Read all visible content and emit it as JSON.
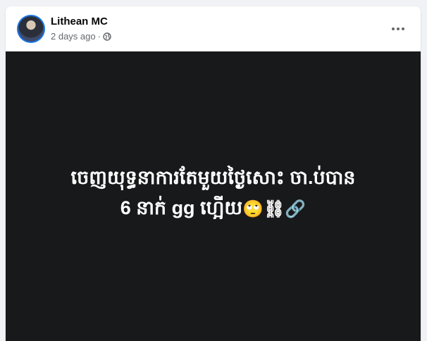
{
  "post": {
    "author": "Lithean MC",
    "timestamp": "2 days ago",
    "separator": "·",
    "privacy_icon": "globe-icon",
    "more_icon": "more-options-icon",
    "text_line1": "ចេញយុទ្ធនាការតែមួយថ្ងៃសោះ ចា.ប់បាន",
    "text_line2": "6 នាក់ gg ហ្អើយ",
    "text_emojis": "🙄⛓🔗"
  },
  "colors": {
    "page_bg": "#f0f2f5",
    "card_bg": "#ffffff",
    "image_bg": "#18191a",
    "accent": "#1b74e4"
  }
}
